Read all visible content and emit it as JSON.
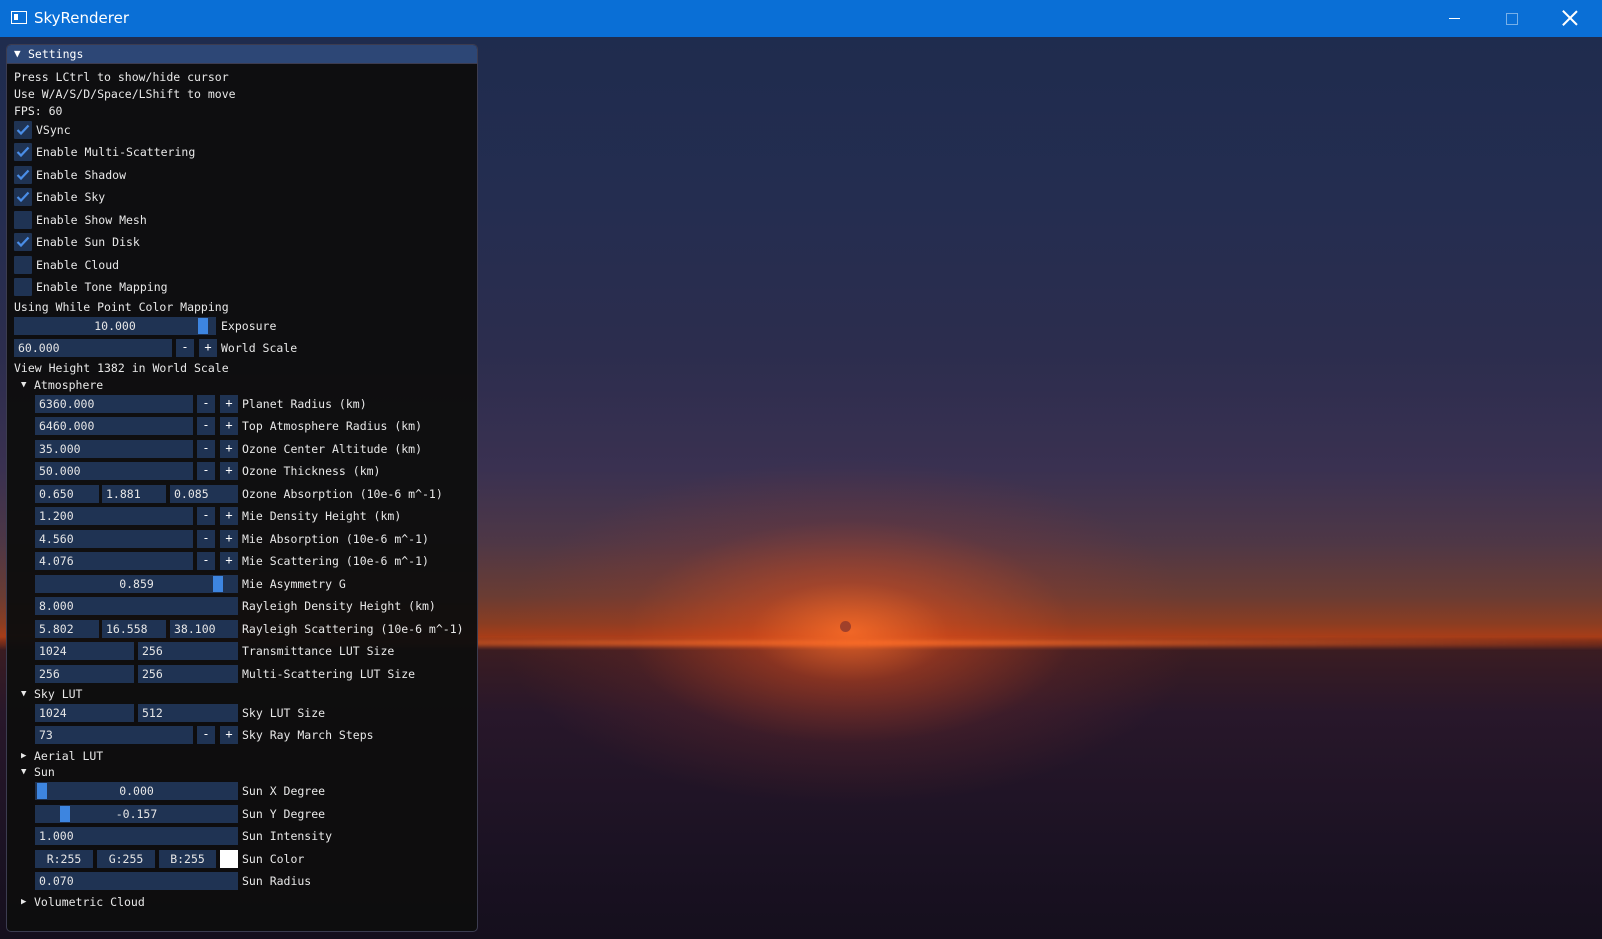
{
  "window": {
    "title": "SkyRenderer"
  },
  "panel": {
    "title": "Settings",
    "info": [
      "Press LCtrl to show/hide cursor",
      "Use W/A/S/D/Space/LShift to move",
      "FPS: 60"
    ],
    "checkboxes": [
      {
        "label": "VSync",
        "checked": true
      },
      {
        "label": "Enable Multi-Scattering",
        "checked": true
      },
      {
        "label": "Enable Shadow",
        "checked": true
      },
      {
        "label": "Enable Sky",
        "checked": true
      },
      {
        "label": "Enable Show Mesh",
        "checked": false
      },
      {
        "label": "Enable Sun Disk",
        "checked": true
      },
      {
        "label": "Enable Cloud",
        "checked": false
      },
      {
        "label": "Enable Tone Mapping",
        "checked": false
      }
    ],
    "color_mapping_text": "Using While Point Color Mapping",
    "exposure": {
      "value": "10.000",
      "label": "Exposure",
      "fraction": 0.97
    },
    "world_scale": {
      "value": "60.000",
      "label": "World Scale"
    },
    "view_height_text": "View Height 1382 in World Scale",
    "stepper_minus": "-",
    "stepper_plus": "+",
    "atmosphere": {
      "header": "Atmosphere",
      "planet_radius": {
        "value": "6360.000",
        "label": "Planet Radius (km)"
      },
      "top_radius": {
        "value": "6460.000",
        "label": "Top Atmosphere Radius (km)"
      },
      "ozone_center": {
        "value": "35.000",
        "label": "Ozone Center Altitude (km)"
      },
      "ozone_thickness": {
        "value": "50.000",
        "label": "Ozone Thickness (km)"
      },
      "ozone_absorption": {
        "values": [
          "0.650",
          "1.881",
          "0.085"
        ],
        "label": "Ozone Absorption (10e-6 m^-1)"
      },
      "mie_density": {
        "value": "1.200",
        "label": "Mie Density Height (km)"
      },
      "mie_absorption": {
        "value": "4.560",
        "label": "Mie Absorption (10e-6 m^-1)"
      },
      "mie_scattering": {
        "value": "4.076",
        "label": "Mie Scattering (10e-6 m^-1)"
      },
      "mie_asymmetry": {
        "value": "0.859",
        "label": "Mie Asymmetry G",
        "fraction": 0.93
      },
      "rayleigh_density": {
        "value": "8.000",
        "label": "Rayleigh Density Height (km)"
      },
      "rayleigh_scattering": {
        "values": [
          "5.802",
          "16.558",
          "38.100"
        ],
        "label": "Rayleigh Scattering (10e-6 m^-1)"
      },
      "transmittance_lut": {
        "values": [
          "1024",
          "256"
        ],
        "label": "Transmittance LUT Size"
      },
      "multi_scattering_lut": {
        "values": [
          "256",
          "256"
        ],
        "label": "Multi-Scattering LUT Size"
      }
    },
    "sky_lut": {
      "header": "Sky LUT",
      "size": {
        "values": [
          "1024",
          "512"
        ],
        "label": "Sky LUT Size"
      },
      "ray_march_steps": {
        "value": "73",
        "label": "Sky Ray March Steps"
      }
    },
    "aerial_lut": {
      "header": "Aerial LUT"
    },
    "sun": {
      "header": "Sun",
      "x_degree": {
        "value": "0.000",
        "label": "Sun X Degree",
        "fraction": 0.0
      },
      "y_degree": {
        "value": "-0.157",
        "label": "Sun Y Degree",
        "fraction": 0.12
      },
      "intensity": {
        "value": "1.000",
        "label": "Sun Intensity"
      },
      "color": {
        "values": [
          "R:255",
          "G:255",
          "B:255"
        ],
        "label": "Sun Color",
        "swatch": "#ffffff"
      },
      "radius": {
        "value": "0.070",
        "label": "Sun Radius"
      }
    },
    "volumetric_cloud": {
      "header": "Volumetric Cloud"
    }
  },
  "colors": {
    "titlebar": "#0a6fd6",
    "panel_header": "#2d4776",
    "frame_bg": "#1f3353",
    "accent": "#3d85e0"
  }
}
